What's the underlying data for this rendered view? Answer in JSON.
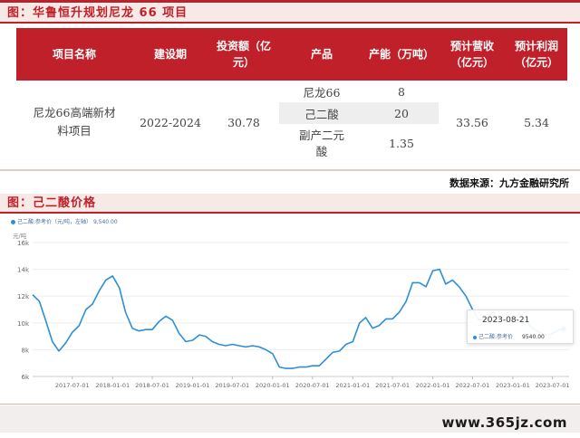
{
  "section1": {
    "title": "图：华鲁恒升规划尼龙 66 项目"
  },
  "table": {
    "headers": [
      "项目名称",
      "建设期",
      "投资额（亿元）",
      "产品",
      "产能（万吨）",
      "预计营收（亿元）",
      "预计利润（亿元）"
    ],
    "row": {
      "name": "尼龙66高端新材料项目",
      "period": "2022-2024",
      "investment": "30.78",
      "revenue": "33.56",
      "profit": "5.34"
    },
    "products": [
      {
        "name": "尼龙66",
        "capacity": "8"
      },
      {
        "name": "己二酸",
        "capacity": "20"
      },
      {
        "name": "副产二元酸",
        "capacity": "1.35"
      }
    ]
  },
  "source": "数据来源：九方金融研究所",
  "section2": {
    "title": "图：己二酸价格"
  },
  "chart_meta": {
    "legend": "己二酸:参考价（元/吨，左轴） 9,540.00",
    "yunit": "元/吨",
    "tooltip_date": "2023-08-21",
    "tooltip_series": "己二酸:参考价",
    "tooltip_value": "9540.00"
  },
  "chart_data": {
    "type": "line",
    "title": "",
    "xlabel": "",
    "ylabel": "元/吨",
    "ylim": [
      6000,
      16000
    ],
    "yticks": [
      "6k",
      "8k",
      "10k",
      "12k",
      "14k",
      "16k"
    ],
    "xticks": [
      "2017-07-01",
      "2018-01-01",
      "2018-07-01",
      "2019-01-01",
      "2019-07-01",
      "2020-01-01",
      "2020-07-01",
      "2021-01-01",
      "2021-07-01",
      "2022-01-01",
      "2022-07-01",
      "2023-01-01",
      "2023-07-01"
    ],
    "series": [
      {
        "name": "己二酸:参考价",
        "color": "#2c8fd6",
        "points": [
          [
            "2017-01-01",
            12100
          ],
          [
            "2017-02-01",
            11600
          ],
          [
            "2017-03-01",
            10200
          ],
          [
            "2017-04-01",
            8600
          ],
          [
            "2017-05-01",
            7900
          ],
          [
            "2017-06-01",
            8500
          ],
          [
            "2017-07-01",
            9300
          ],
          [
            "2017-08-01",
            9800
          ],
          [
            "2017-09-01",
            11000
          ],
          [
            "2017-10-01",
            11400
          ],
          [
            "2017-11-01",
            12400
          ],
          [
            "2017-12-01",
            13200
          ],
          [
            "2018-01-01",
            13500
          ],
          [
            "2018-02-01",
            12600
          ],
          [
            "2018-03-01",
            10800
          ],
          [
            "2018-04-01",
            9600
          ],
          [
            "2018-05-01",
            9400
          ],
          [
            "2018-06-01",
            9500
          ],
          [
            "2018-07-01",
            9500
          ],
          [
            "2018-08-01",
            10100
          ],
          [
            "2018-09-01",
            10500
          ],
          [
            "2018-10-01",
            10200
          ],
          [
            "2018-11-01",
            9200
          ],
          [
            "2018-12-01",
            8600
          ],
          [
            "2019-01-01",
            8700
          ],
          [
            "2019-02-01",
            9100
          ],
          [
            "2019-03-01",
            9000
          ],
          [
            "2019-04-01",
            8600
          ],
          [
            "2019-05-01",
            8400
          ],
          [
            "2019-06-01",
            8300
          ],
          [
            "2019-07-01",
            8400
          ],
          [
            "2019-08-01",
            8300
          ],
          [
            "2019-09-01",
            8200
          ],
          [
            "2019-10-01",
            8300
          ],
          [
            "2019-11-01",
            8200
          ],
          [
            "2019-12-01",
            8000
          ],
          [
            "2020-01-01",
            7700
          ],
          [
            "2020-02-01",
            6700
          ],
          [
            "2020-03-01",
            6600
          ],
          [
            "2020-04-01",
            6600
          ],
          [
            "2020-05-01",
            6700
          ],
          [
            "2020-06-01",
            6700
          ],
          [
            "2020-07-01",
            6800
          ],
          [
            "2020-08-01",
            6800
          ],
          [
            "2020-09-01",
            7300
          ],
          [
            "2020-10-01",
            7800
          ],
          [
            "2020-11-01",
            7900
          ],
          [
            "2020-12-01",
            8400
          ],
          [
            "2021-01-01",
            8600
          ],
          [
            "2021-02-01",
            10000
          ],
          [
            "2021-03-01",
            10400
          ],
          [
            "2021-04-01",
            9600
          ],
          [
            "2021-05-01",
            9800
          ],
          [
            "2021-06-01",
            10300
          ],
          [
            "2021-07-01",
            10300
          ],
          [
            "2021-08-01",
            10800
          ],
          [
            "2021-09-01",
            11600
          ],
          [
            "2021-10-01",
            13000
          ],
          [
            "2021-11-01",
            13000
          ],
          [
            "2021-12-01",
            12700
          ],
          [
            "2022-01-01",
            13900
          ],
          [
            "2022-02-01",
            14000
          ],
          [
            "2022-03-01",
            12900
          ],
          [
            "2022-04-01",
            13200
          ],
          [
            "2022-05-01",
            12700
          ],
          [
            "2022-06-01",
            12000
          ],
          [
            "2022-07-01",
            11000
          ],
          [
            "2022-08-01",
            10200
          ],
          [
            "2022-09-01",
            10300
          ],
          [
            "2022-10-01",
            10800
          ],
          [
            "2022-11-01",
            10300
          ],
          [
            "2022-12-01",
            10100
          ],
          [
            "2023-01-01",
            10100
          ],
          [
            "2023-02-01",
            10700
          ],
          [
            "2023-03-01",
            10100
          ],
          [
            "2023-04-01",
            9600
          ],
          [
            "2023-05-01",
            9300
          ],
          [
            "2023-06-01",
            9100
          ],
          [
            "2023-07-01",
            9200
          ],
          [
            "2023-08-01",
            9500
          ],
          [
            "2023-08-21",
            9540
          ]
        ]
      }
    ]
  },
  "watermark": "www.365jz.com"
}
